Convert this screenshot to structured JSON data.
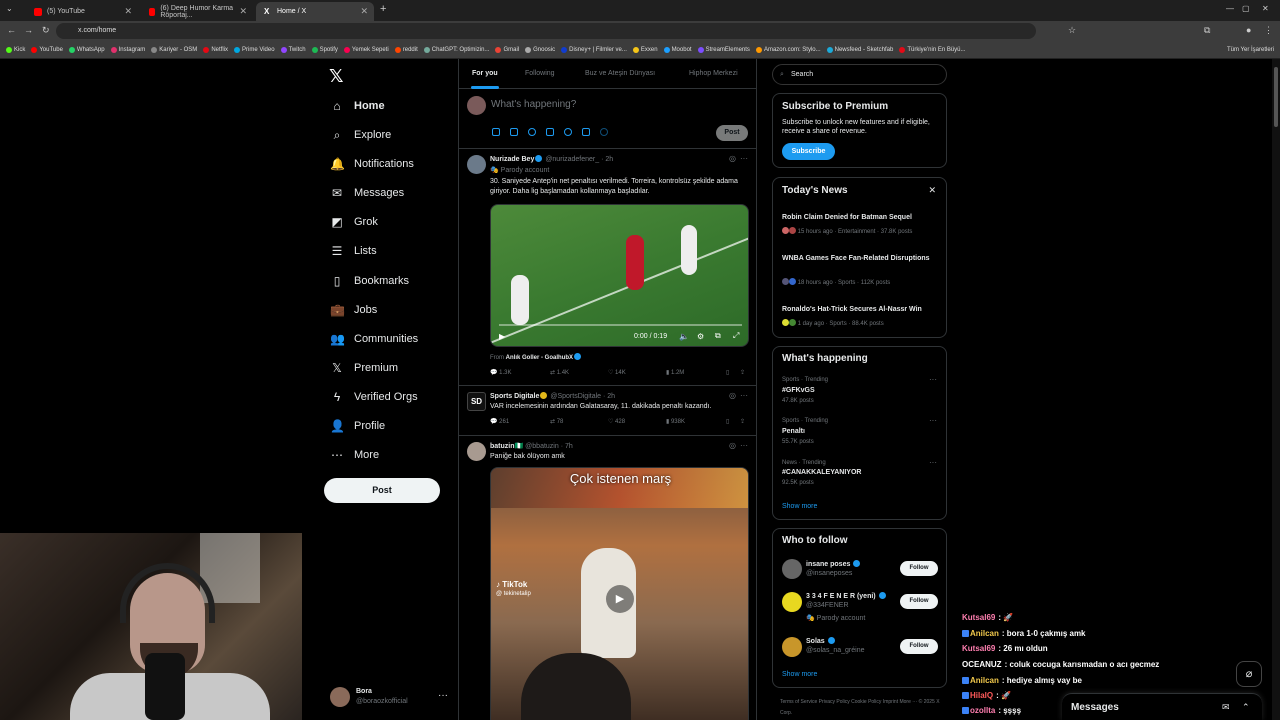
{
  "browser": {
    "tabs": [
      {
        "title": "(5) YouTube",
        "active": false
      },
      {
        "title": "(6) Deep Humor Karma Röportaj...",
        "active": false
      },
      {
        "title": "Home / X",
        "active": true
      }
    ],
    "url": "x.com/home",
    "bookmarks": [
      "Kick",
      "YouTube",
      "WhatsApp",
      "Instagram",
      "Kariyer - OSM",
      "Netflix",
      "Prime Video",
      "Twitch",
      "Spotify",
      "Yemek Sepeti",
      "reddit",
      "ChatGPT: Optimizin...",
      "Gmail",
      "Gnoosic",
      "Disney+ | Filmler ve...",
      "Exxen",
      "Moobot",
      "StreamElements",
      "Amazon.com: Stylo...",
      "Newsfeed - Sketchfab",
      "Türkiye'nin En Büyü..."
    ],
    "all_bookmarks": "Tüm Yer İşaretleri"
  },
  "nav": {
    "items": [
      {
        "label": "Home",
        "icon": "home-icon",
        "glyph": "⌂"
      },
      {
        "label": "Explore",
        "icon": "search-icon",
        "glyph": "⌕"
      },
      {
        "label": "Notifications",
        "icon": "bell-icon",
        "glyph": "🔔"
      },
      {
        "label": "Messages",
        "icon": "envelope-icon",
        "glyph": "✉"
      },
      {
        "label": "Grok",
        "icon": "grok-icon",
        "glyph": "◩"
      },
      {
        "label": "Lists",
        "icon": "list-icon",
        "glyph": "☰"
      },
      {
        "label": "Bookmarks",
        "icon": "bookmark-icon",
        "glyph": "▯"
      },
      {
        "label": "Jobs",
        "icon": "briefcase-icon",
        "glyph": "💼"
      },
      {
        "label": "Communities",
        "icon": "people-icon",
        "glyph": "👥"
      },
      {
        "label": "Premium",
        "icon": "x-logo-icon",
        "glyph": "𝕏"
      },
      {
        "label": "Verified Orgs",
        "icon": "lightning-icon",
        "glyph": "ϟ"
      },
      {
        "label": "Profile",
        "icon": "person-icon",
        "glyph": "👤"
      },
      {
        "label": "More",
        "icon": "more-circle-icon",
        "glyph": "⋯"
      }
    ],
    "post_label": "Post",
    "account": {
      "name": "Bora",
      "handle": "@boraozkofficial"
    }
  },
  "timeline": {
    "tabs": [
      "For you",
      "Following",
      "Buz ve Ateşin Dünyası",
      "Hiphop Merkezi"
    ],
    "composer_placeholder": "What's happening?",
    "composer_post": "Post",
    "tweets": [
      {
        "name": "Nurizade Bey",
        "handle": "@nurizadefener_ · 2h",
        "sub": "🎭 Parody account",
        "text": "30. Saniyede Antep'in net penaltısı verilmedi. Torreira, kontrolsüz şekilde adama giriyor. Daha lig başlamadan kollanmaya başladılar.",
        "video_time": "0:00 / 0:19",
        "from": "From ",
        "from_src": "Anlık Goller - GoalhubX",
        "actions": [
          "1.3K",
          "1.4K",
          "14K",
          "1.2M"
        ]
      },
      {
        "name": "Sports Digitale",
        "handle": "@SportsDigitale · 2h",
        "text": "VAR incelemesinin ardından Galatasaray, 11. dakikada penaltı kazandı.",
        "actions": [
          "261",
          "78",
          "428",
          "938K"
        ]
      },
      {
        "name": "batuzin🇳🇬",
        "handle": "@bbatuzin · 7h",
        "text": "Paniğe bak ölüyom amk",
        "video_caption": "Çok istenen marş",
        "tiktok": "TikTok",
        "tiktok_user": "@ tekinetalip"
      }
    ]
  },
  "sidebar": {
    "search_placeholder": "Search",
    "premium": {
      "title": "Subscribe to Premium",
      "text": "Subscribe to unlock new features and if eligible, receive a share of revenue.",
      "button": "Subscribe"
    },
    "news": {
      "title": "Today's News",
      "items": [
        {
          "title": "Robin Claim Denied for Batman Sequel",
          "meta": "15 hours ago · Entertainment · 37.8K posts"
        },
        {
          "title": "WNBA Games Face Fan-Related Disruptions",
          "meta": "18 hours ago · Sports · 112K posts"
        },
        {
          "title": "Ronaldo's Hat-Trick Secures Al-Nassr Win",
          "meta": "1 day ago · Sports · 88.4K posts"
        }
      ]
    },
    "happening": {
      "title": "What's happening",
      "trends": [
        {
          "category": "Sports · Trending",
          "name": "#GFKvGS",
          "posts": "47.8K posts"
        },
        {
          "category": "Sports · Trending",
          "name": "Penaltı",
          "posts": "55.7K posts"
        },
        {
          "category": "News · Trending",
          "name": "#CANAKKALEYANIYOR",
          "posts": "92.5K posts"
        }
      ],
      "show_more": "Show more"
    },
    "follow": {
      "title": "Who to follow",
      "users": [
        {
          "name": "insane poses",
          "handle": "@insaneposes",
          "extra": ""
        },
        {
          "name": "3 3 4 F E N E R (yeni)",
          "handle": "@334FENER",
          "extra": "🎭 Parody account"
        },
        {
          "name": "Solas",
          "handle": "@solas_na_gréine",
          "extra": ""
        }
      ],
      "button": "Follow",
      "show_more": "Show more"
    },
    "footer": "Terms of Service   Privacy Policy   Cookie Policy   Imprint   More ···   © 2025 X Corp."
  },
  "chat": [
    {
      "user": "Kutsal69",
      "msg": ": 🚀",
      "color": "#ff7fb0"
    },
    {
      "user": "Anilcan",
      "msg": ": bora 1-0 çakmış amk",
      "color": "#f2c94c"
    },
    {
      "user": "Kutsal69",
      "msg": ": 26 mı oldun",
      "color": "#ff7fb0"
    },
    {
      "user": "OCEANUZ",
      "msg": ": coluk cocuga karısmadan o acı gecmez",
      "color": "#ffffff"
    },
    {
      "user": "Anilcan",
      "msg": ": hediye almış vay be",
      "color": "#f2c94c"
    },
    {
      "user": "HilalQ",
      "msg": ": 🚀",
      "color": "#ff5a5a"
    },
    {
      "user": "ozollta",
      "msg": ": şşşş",
      "color": "#ff7fb0"
    }
  ],
  "messages_drawer": "Messages"
}
